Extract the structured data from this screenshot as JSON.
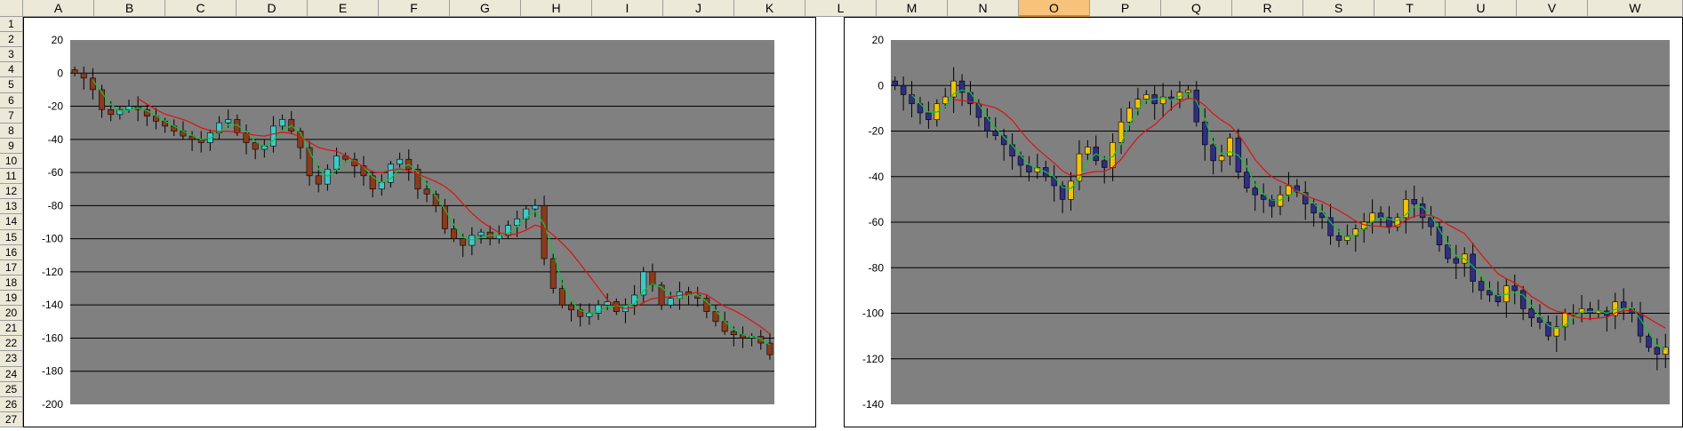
{
  "sheet": {
    "columns": [
      "A",
      "B",
      "C",
      "D",
      "E",
      "F",
      "G",
      "H",
      "I",
      "J",
      "K",
      "L",
      "M",
      "N",
      "O",
      "P",
      "Q",
      "R",
      "S",
      "T",
      "U",
      "V",
      "W"
    ],
    "selected_column": "O",
    "rows": [
      "1",
      "2",
      "3",
      "4",
      "5",
      "6",
      "7",
      "8",
      "9",
      "10",
      "11",
      "12",
      "13",
      "14",
      "15",
      "16",
      "17",
      "18",
      "19",
      "20",
      "21",
      "22",
      "23",
      "24",
      "25",
      "26",
      "27"
    ]
  },
  "colors": {
    "plot_bg": "#808080",
    "gridline": "#000000",
    "chart1_up": "#3ec9c9",
    "chart1_down": "#8b3a1c",
    "chart2_up": "#f2c500",
    "chart2_down": "#2e2e82",
    "ma_fast": "#12c43a",
    "ma_slow": "#e01010",
    "wick": "#000000"
  },
  "chart_data": [
    {
      "type": "candlestick",
      "ylim": [
        -200,
        20
      ],
      "yticks": [
        "20",
        "0",
        "-20",
        "-40",
        "-60",
        "-80",
        "-100",
        "-120",
        "-140",
        "-160",
        "-180",
        "-200"
      ],
      "grid": true,
      "series": [
        {
          "kind": "close",
          "values": [
            0,
            -3,
            -10,
            -22,
            -25,
            -22,
            -20,
            -22,
            -26,
            -29,
            -32,
            -35,
            -38,
            -40,
            -42,
            -36,
            -30,
            -28,
            -36,
            -42,
            -46,
            -44,
            -32,
            -28,
            -35,
            -45,
            -62,
            -67,
            -58,
            -50,
            -52,
            -56,
            -62,
            -70,
            -66,
            -55,
            -52,
            -58,
            -70,
            -73,
            -80,
            -94,
            -100,
            -104,
            -98,
            -96,
            -100,
            -98,
            -92,
            -88,
            -82,
            -80,
            -112,
            -130,
            -140,
            -143,
            -147,
            -145,
            -140,
            -138,
            -144,
            -140,
            -134,
            -120,
            -128,
            -140,
            -136,
            -132,
            -134,
            -136,
            -144,
            -150,
            -156,
            -158,
            -160,
            -159,
            -163,
            -170
          ]
        },
        {
          "kind": "ma_fast",
          "period": 3
        },
        {
          "kind": "ma_slow",
          "period": 8
        }
      ]
    },
    {
      "type": "candlestick",
      "ylim": [
        -140,
        20
      ],
      "yticks": [
        "20",
        "0",
        "-20",
        "-40",
        "-60",
        "-80",
        "-100",
        "-120",
        "-140"
      ],
      "grid": true,
      "series": [
        {
          "kind": "close",
          "values": [
            0,
            -4,
            -8,
            -12,
            -15,
            -8,
            -5,
            2,
            -3,
            -8,
            -14,
            -20,
            -22,
            -26,
            -31,
            -35,
            -38,
            -36,
            -40,
            -44,
            -50,
            -42,
            -30,
            -27,
            -33,
            -36,
            -25,
            -16,
            -10,
            -6,
            -4,
            -8,
            -5,
            -6,
            -3,
            -2,
            -16,
            -26,
            -33,
            -31,
            -23,
            -38,
            -45,
            -48,
            -50,
            -53,
            -48,
            -44,
            -47,
            -52,
            -56,
            -58,
            -66,
            -68,
            -66,
            -63,
            -60,
            -56,
            -58,
            -62,
            -58,
            -50,
            -52,
            -58,
            -62,
            -70,
            -76,
            -78,
            -74,
            -86,
            -90,
            -92,
            -95,
            -88,
            -90,
            -98,
            -102,
            -104,
            -110,
            -106,
            -100,
            -100,
            -98,
            -100,
            -99,
            -101,
            -95,
            -98,
            -100,
            -110,
            -115,
            -118,
            -115
          ]
        },
        {
          "kind": "ma_fast",
          "period": 3
        },
        {
          "kind": "ma_slow",
          "period": 8
        }
      ]
    }
  ]
}
